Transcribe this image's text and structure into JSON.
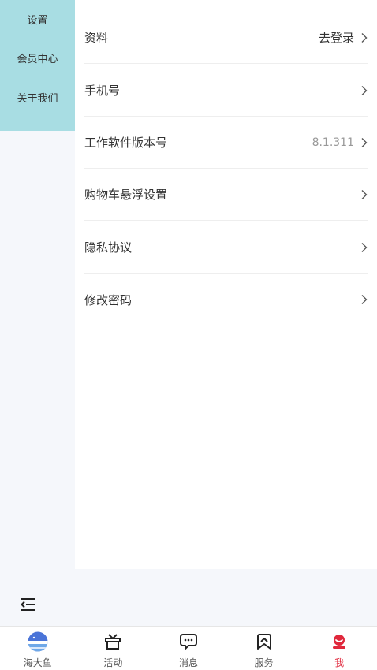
{
  "sidebar": {
    "items": [
      {
        "label": "设置"
      },
      {
        "label": "会员中心"
      },
      {
        "label": "关于我们"
      }
    ]
  },
  "settings": {
    "rows": [
      {
        "label": "资料",
        "value": "去登录"
      },
      {
        "label": "手机号",
        "value": ""
      },
      {
        "label": "工作软件版本号",
        "value": "8.1.311"
      },
      {
        "label": "购物车悬浮设置",
        "value": ""
      },
      {
        "label": "隐私协议",
        "value": ""
      },
      {
        "label": "修改密码",
        "value": ""
      }
    ]
  },
  "tabbar": {
    "tabs": [
      {
        "label": "海大鱼",
        "icon": "fish-logo-icon"
      },
      {
        "label": "活动",
        "icon": "gift-box-icon"
      },
      {
        "label": "消息",
        "icon": "chat-bubble-icon"
      },
      {
        "label": "服务",
        "icon": "bookmark-service-icon"
      },
      {
        "label": "我",
        "icon": "user-profile-icon"
      }
    ],
    "active_index": 4,
    "active_color": "#e0283c"
  },
  "colors": {
    "sidebar_menu_bg": "#a8dde3",
    "page_bg": "#f5f7fb"
  }
}
